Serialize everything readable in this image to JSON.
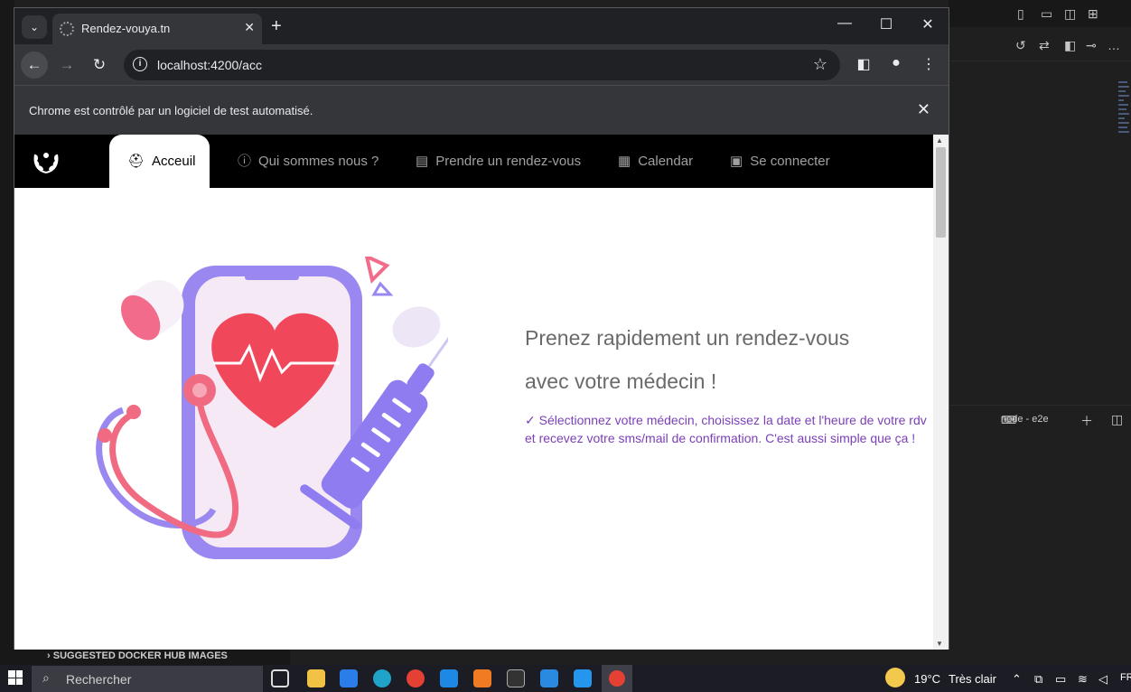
{
  "browser": {
    "tab_title": "Rendez-vouya.tn",
    "url": "localhost:4200/acc",
    "infobar_text": "Chrome est contrôlé par un logiciel de test automatisé."
  },
  "navbar": {
    "items": [
      {
        "label": "Acceuil",
        "icon": "first-aid-icon",
        "active": true
      },
      {
        "label": "Qui sommes nous ?",
        "icon": "info-icon",
        "active": false
      },
      {
        "label": "Prendre un rendez-vous",
        "icon": "document-icon",
        "active": false
      },
      {
        "label": "Calendar",
        "icon": "calendar-icon",
        "active": false
      },
      {
        "label": "Se connecter",
        "icon": "user-badge-icon",
        "active": false
      }
    ]
  },
  "hero": {
    "title_line1": "Prenez rapidement un rendez-vous",
    "title_line2": "avec votre médecin !",
    "description": "✓ Sélectionnez votre médecin, choisissez la date et l'heure de votre rdv et recevez votre sms/mail de confirmation. C'est aussi simple que ça !"
  },
  "vscode": {
    "panel_label": "SUGGESTED DOCKER HUB IMAGES",
    "terminal_label": "node - e2e"
  },
  "taskbar": {
    "search_placeholder": "Rechercher",
    "weather": "19°C",
    "weather_desc": "Très clair",
    "lang": "FR"
  },
  "colors": {
    "navbar_bg": "#000000",
    "accent_purple": "#7b3fb8",
    "heart_red": "#f0475a",
    "phone_purple": "#9a87f0"
  }
}
